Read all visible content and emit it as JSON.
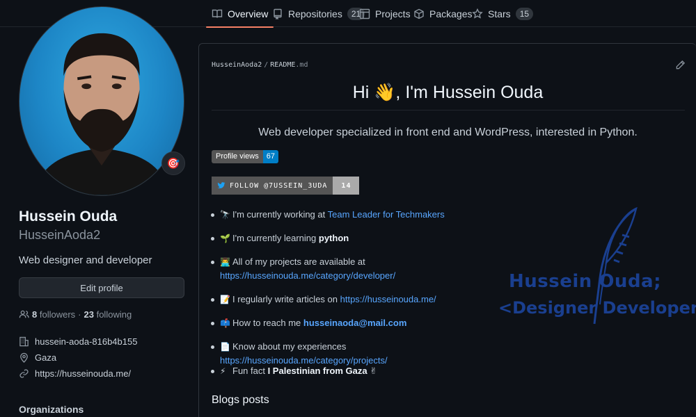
{
  "tabs": [
    {
      "label": "Overview",
      "count": null,
      "icon": "book-icon",
      "active": true
    },
    {
      "label": "Repositories",
      "count": "21",
      "icon": "repo-icon",
      "active": false
    },
    {
      "label": "Projects",
      "count": null,
      "icon": "project-icon",
      "active": false
    },
    {
      "label": "Packages",
      "count": null,
      "icon": "package-icon",
      "active": false
    },
    {
      "label": "Stars",
      "count": "15",
      "icon": "star-icon",
      "active": false
    }
  ],
  "profile": {
    "name": "Hussein Ouda",
    "login": "HusseinAoda2",
    "bio": "Web designer and developer",
    "edit_label": "Edit profile",
    "followers_count": "8",
    "followers_label": "followers",
    "dot": "·",
    "following_count": "23",
    "following_label": "following",
    "status_emoji": "🎯",
    "company": "hussein-aoda-816b4b155",
    "location": "Gaza",
    "website": "https://husseinouda.me/",
    "organizations_title": "Organizations"
  },
  "readme": {
    "path_user": "HusseinAoda2",
    "path_sep": "/",
    "path_file": "README",
    "path_ext": ".md",
    "heading": "Hi 👋, I'm Hussein Ouda",
    "subtitle": "Web developer specialized in front end and WordPress, interested in Python.",
    "views_label": "Profile views",
    "views_count": "67",
    "twitter_label": "FOLLOW @7USSEIN_3UDA",
    "twitter_count": "14",
    "items": [
      {
        "emoji": "🔭",
        "text": "I'm currently working at ",
        "link": "Team Leader for Techmakers"
      },
      {
        "emoji": "🌱",
        "text": "I'm currently learning ",
        "bold": "python"
      },
      {
        "emoji": "👨‍💻",
        "text": "All of my projects are available at ",
        "link": "https://husseinouda.me/category/developer/"
      },
      {
        "emoji": "📝",
        "text": "I regularly write articles on ",
        "link": "https://husseinouda.me/"
      },
      {
        "emoji": "📫",
        "text": "How to reach me ",
        "boldlink": "husseinaoda@mail.com"
      },
      {
        "emoji": "📄",
        "text": "Know about my experiences ",
        "link": "https://husseinouda.me/category/projects/"
      },
      {
        "emoji": "⚡",
        "text": "Fun fact ",
        "bold": "I Palestinian from Gaza",
        "tail": "✌"
      }
    ],
    "blogs_title": "Blogs posts",
    "logo_line1": "Hussein Ouda;",
    "logo_line2": "<Designer Developer>"
  },
  "colors": {
    "accent_underline": "#f78166",
    "link": "#58a6ff",
    "logo_blue": "#1a3f8f"
  }
}
